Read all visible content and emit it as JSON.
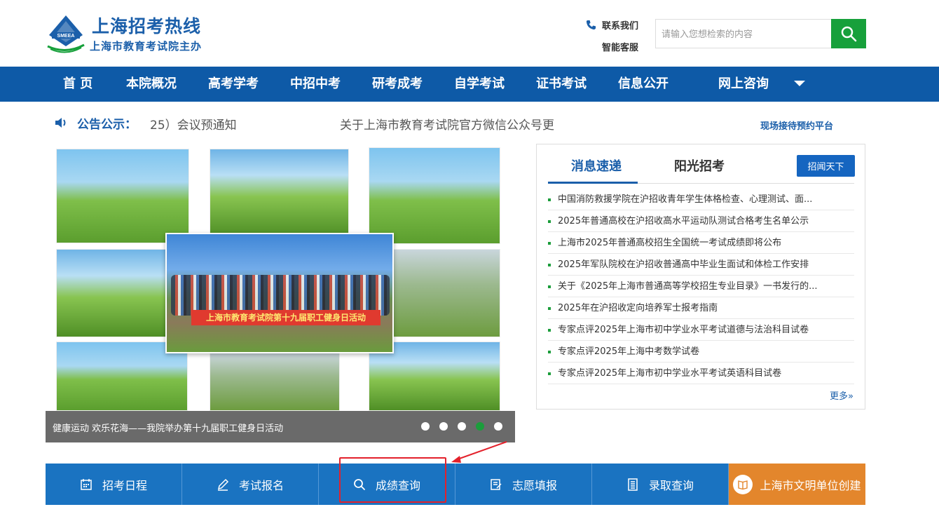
{
  "header": {
    "title": "上海招考热线",
    "subtitle": "上海市教育考试院主办",
    "logo_text": "SMEEA",
    "contact_label": "联系我们",
    "service_label": "智能客服",
    "search_placeholder": "请输入您想检索的内容"
  },
  "nav": {
    "items": [
      "首 页",
      "本院概况",
      "高考学考",
      "中招中考",
      "研考成考",
      "自学考试",
      "证书考试",
      "信息公开",
      "网上咨询"
    ]
  },
  "notice": {
    "label": "公告公示：",
    "text1": "25）会议预通知",
    "text2": "关于上海市教育考试院官方微信公众号更",
    "appointment": "现场接待预约平台"
  },
  "carousel": {
    "banner_text": "上海市教育考试院第十九届职工健身日活动",
    "caption": "健康运动 欢乐花海——我院举办第十九届职工健身日活动",
    "slide_count": 5,
    "active_slide": 4
  },
  "news": {
    "tabs": [
      "消息速递",
      "阳光招考"
    ],
    "tab_button": "招闻天下",
    "items": [
      "中国消防救援学院在沪招收青年学生体格检查、心理测试、面...",
      "2025年普通高校在沪招收高水平运动队测试合格考生名单公示",
      "上海市2025年普通高校招生全国统一考试成绩即将公布",
      "2025年军队院校在沪招收普通高中毕业生面试和体检工作安排",
      "关于《2025年上海市普通高等学校招生专业目录》一书发行的...",
      "2025年在沪招收定向培养军士报考指南",
      "专家点评2025年上海市初中学业水平考试道德与法治科目试卷",
      "专家点评2025年上海中考数学试卷",
      "专家点评2025年上海市初中学业水平考试英语科目试卷"
    ],
    "more": "更多»"
  },
  "quickbar": {
    "items": [
      "招考日程",
      "考试报名",
      "成绩查询",
      "志愿填报",
      "录取查询",
      "上海市文明单位创建"
    ]
  }
}
